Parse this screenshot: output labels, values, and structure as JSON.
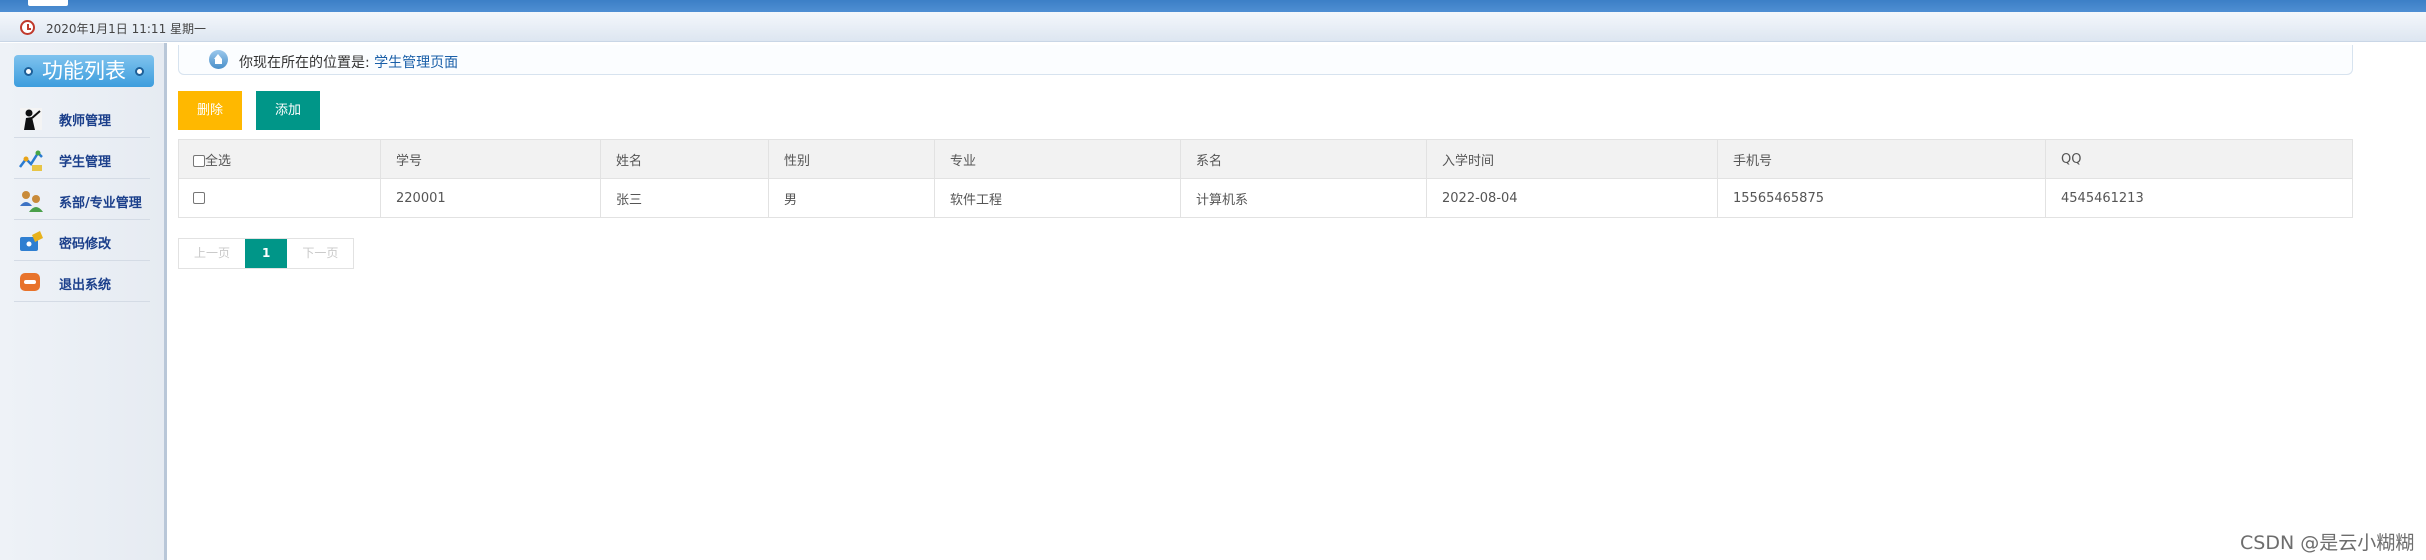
{
  "header": {
    "date_text": "2020年1月1日 11:11 星期一"
  },
  "sidebar": {
    "title": "功能列表",
    "items": [
      {
        "label": "教师管理",
        "icon": "teacher-icon"
      },
      {
        "label": "学生管理",
        "icon": "student-icon"
      },
      {
        "label": "系部/专业管理",
        "icon": "department-icon"
      },
      {
        "label": "密码修改",
        "icon": "password-icon"
      },
      {
        "label": "退出系统",
        "icon": "logout-icon"
      }
    ]
  },
  "breadcrumb": {
    "prefix": "你现在所在的位置是: ",
    "current": "学生管理页面"
  },
  "toolbar": {
    "delete_label": "删除",
    "add_label": "添加"
  },
  "table": {
    "select_all_label": "全选",
    "columns": [
      "学号",
      "姓名",
      "性别",
      "专业",
      "系名",
      "入学时间",
      "手机号",
      "QQ"
    ],
    "rows": [
      [
        "220001",
        "张三",
        "男",
        "软件工程",
        "计算机系",
        "2022-08-04",
        "15565465875",
        "4545461213"
      ]
    ]
  },
  "pagination": {
    "prev_label": "上一页",
    "current_page": "1",
    "next_label": "下一页"
  },
  "watermark": "CSDN @是云小糊糊",
  "colors": {
    "delete_button": "#ffb800",
    "add_button": "#009688",
    "active_page": "#009688",
    "menu_header": "#3d9ddd"
  }
}
